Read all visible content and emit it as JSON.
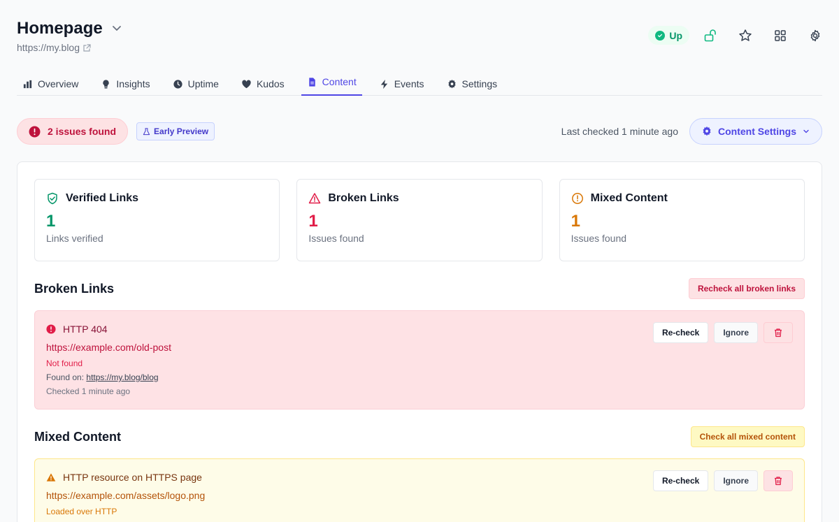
{
  "site": {
    "title": "Homepage",
    "url": "https://my.blog"
  },
  "status": {
    "label": "Up",
    "color": "#10b981"
  },
  "top_icons": [
    "lock-open-icon",
    "star-icon",
    "grid-icon",
    "gear-icon"
  ],
  "tabs": [
    {
      "label": "Overview",
      "icon": "bar-chart-icon"
    },
    {
      "label": "Insights",
      "icon": "lightbulb-icon"
    },
    {
      "label": "Uptime",
      "icon": "clock-icon"
    },
    {
      "label": "Kudos",
      "icon": "heart-icon"
    },
    {
      "label": "Content",
      "icon": "document-icon",
      "active": true
    },
    {
      "label": "Events",
      "icon": "bolt-icon"
    },
    {
      "label": "Settings",
      "icon": "gear-icon"
    }
  ],
  "summary": {
    "issues_label": "2 issues found",
    "preview_label": "Early Preview",
    "last_checked": "Last checked 1 minute ago",
    "settings_label": "Content Settings"
  },
  "stats": [
    {
      "title": "Verified Links",
      "value": "1",
      "sub": "Links verified",
      "color": "#059669"
    },
    {
      "title": "Broken Links",
      "value": "1",
      "sub": "Issues found",
      "color": "#e11d48"
    },
    {
      "title": "Mixed Content",
      "value": "1",
      "sub": "Issues found",
      "color": "#d97706"
    }
  ],
  "broken_links": {
    "title": "Broken Links",
    "action": "Recheck all broken links",
    "items": [
      {
        "title": "HTTP 404",
        "url": "https://example.com/old-post",
        "reason": "Not found",
        "found_on_label": "Found on:",
        "found_on_url": "https://my.blog/blog",
        "checked": "Checked 1 minute ago"
      }
    ]
  },
  "mixed_content": {
    "title": "Mixed Content",
    "action": "Check all mixed content",
    "items": [
      {
        "title": "HTTP resource on HTTPS page",
        "url": "https://example.com/assets/logo.png",
        "reason": "Loaded over HTTP"
      }
    ]
  },
  "buttons": {
    "recheck": "Re-check",
    "ignore": "Ignore"
  }
}
